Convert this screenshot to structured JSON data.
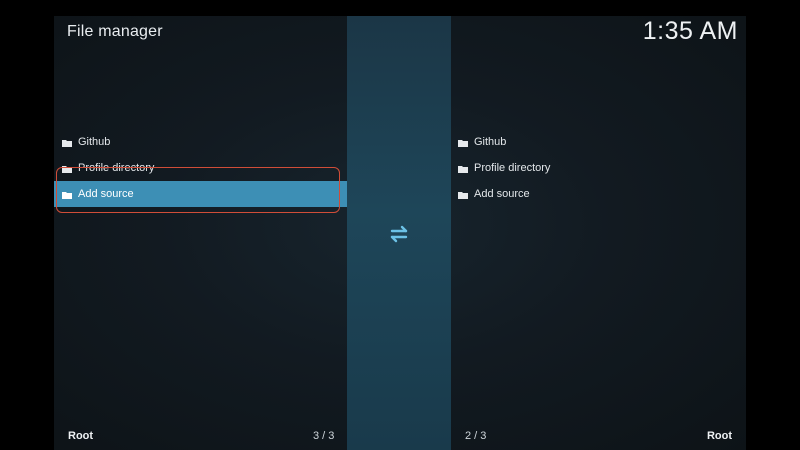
{
  "header": {
    "title": "File manager",
    "clock": "1:35 AM"
  },
  "left_pane": {
    "items": [
      {
        "label": "Github",
        "icon": "folder-icon"
      },
      {
        "label": "Profile directory",
        "icon": "folder-icon"
      },
      {
        "label": "Add source",
        "icon": "folder-icon",
        "selected": true
      }
    ],
    "footer": {
      "path": "Root",
      "count": "3 / 3"
    }
  },
  "right_pane": {
    "items": [
      {
        "label": "Github",
        "icon": "folder-icon"
      },
      {
        "label": "Profile directory",
        "icon": "folder-icon"
      },
      {
        "label": "Add source",
        "icon": "folder-icon"
      }
    ],
    "footer": {
      "path": "Root",
      "count": "2 / 3"
    }
  },
  "center": {
    "icon": "swap-panes-icon"
  },
  "colors": {
    "selection": "#3d8fb5",
    "highlight_border": "#d04d38",
    "band": "#1e4659"
  }
}
